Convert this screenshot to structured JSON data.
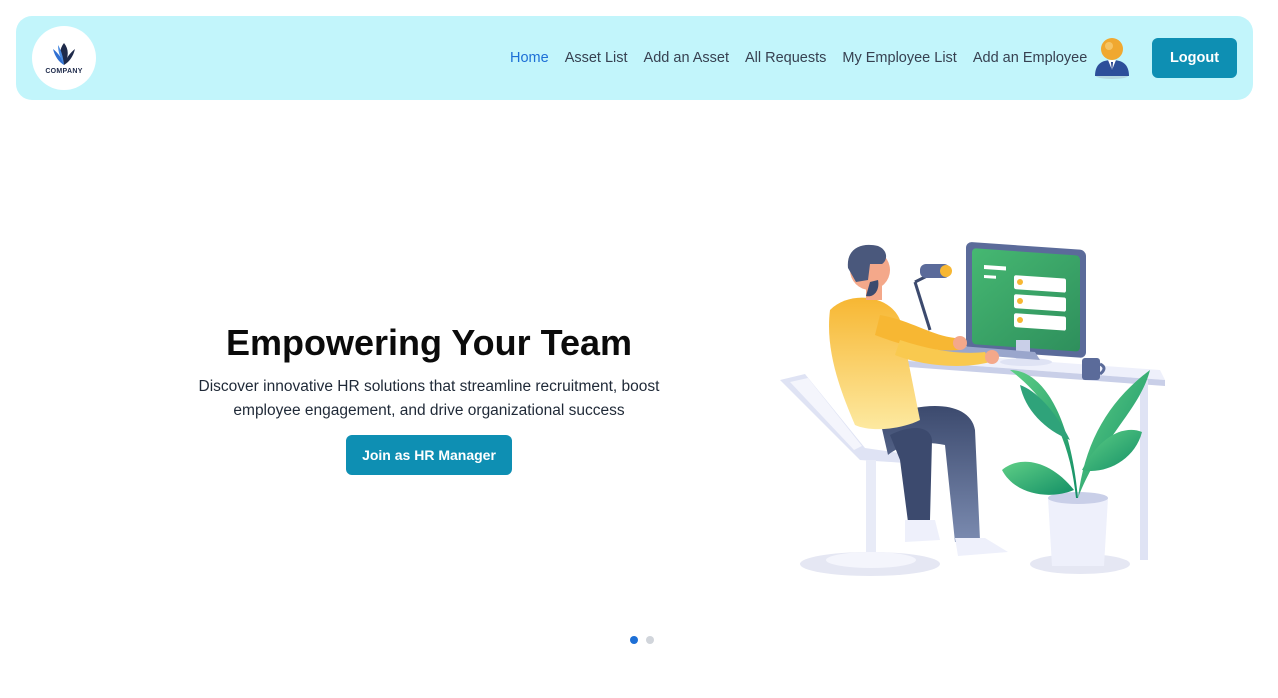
{
  "navbar": {
    "logo_text": "COMPANY",
    "links": [
      {
        "label": "Home",
        "active": true
      },
      {
        "label": "Asset List",
        "active": false
      },
      {
        "label": "Add an Asset",
        "active": false
      },
      {
        "label": "All Requests",
        "active": false
      },
      {
        "label": "My Employee List",
        "active": false
      },
      {
        "label": "Add an Employee",
        "active": false
      }
    ],
    "avatar_icon": "user-avatar-icon",
    "logout_label": "Logout"
  },
  "hero": {
    "title": "Empowering Your Team",
    "subtitle": "Discover innovative HR solutions that streamline recruitment, boost employee engagement, and drive organizational success",
    "cta_label": "Join as HR Manager"
  },
  "carousel": {
    "slide_count": 2,
    "active_index": 0
  },
  "colors": {
    "navbar_bg": "#c2f5fb",
    "accent": "#0e8fb3",
    "active_link": "#1d6fd6"
  }
}
